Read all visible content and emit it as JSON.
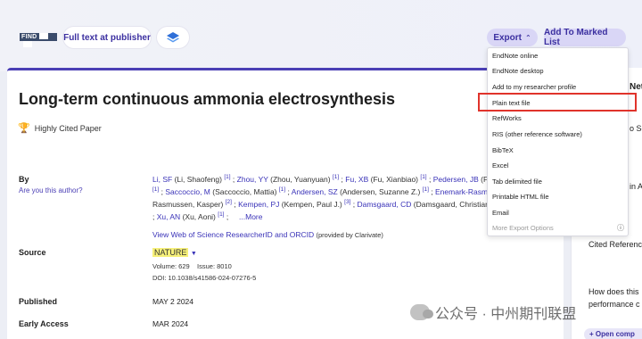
{
  "header": {
    "logo_text": "FIND",
    "full_text_label": "Full text at publisher",
    "export_label": "Export",
    "add_marked_label": "Add To Marked List"
  },
  "article": {
    "title": "Long-term continuous ammonia electrosynthesis",
    "badge": "Highly Cited Paper",
    "by_label": "By",
    "are_you_author": "Are you this author?",
    "author_lines": [
      "Li, SF (Li, Shaofeng) [1] ; Zhou, YY (Zhou, Yuanyuan) [1] ; Fu, XB (Fu, Xianbiao) [1] ; Pedersen, JB (Pe",
      "[1] ; Saccoccio, M (Saccoccio, Mattia) [1] ; Andersen, SZ (Andersen, Suzanne Z.) [1] ; Enemark-Rasm",
      "Rasmussen, Kasper) [2] ; Kempen, PJ (Kempen, Paul J.) [3] ; Damsgaard, CD (Damsgaard, Christian",
      "; Xu, AN (Xu, Aoni) [1] ;     ...More"
    ],
    "researcher_link": "View Web of Science ResearcherID and ORCID",
    "provided_by": "(provided by Clarivate)",
    "source_label": "Source",
    "source_name": "NATURE",
    "volume": "Volume: 629",
    "issue": "Issue: 8010",
    "doi": "DOI: 10.1038/s41586-024-07276-5",
    "published_label": "Published",
    "published_value": "MAY 2 2024",
    "early_access_label": "Early Access",
    "early_access_value": "MAR 2024"
  },
  "export_menu": {
    "items": [
      "EndNote online",
      "EndNote desktop",
      "Add to my researcher profile",
      "Plain text file",
      "RefWorks",
      "RIS (other reference software)",
      "BibTeX",
      "Excel",
      "Tab delimited file",
      "Printable HTML file",
      "Email",
      "More Export Options"
    ],
    "highlighted": "Plain text file"
  },
  "right_panel": {
    "line1": "Net",
    "line2": "o Scie",
    "line3": "in A",
    "line4": "Cited Reference",
    "line5": "How does this",
    "line6": "performance c",
    "open_label": "+ Open comp"
  },
  "watermark": "公众号 · 中州期刊联盟"
}
